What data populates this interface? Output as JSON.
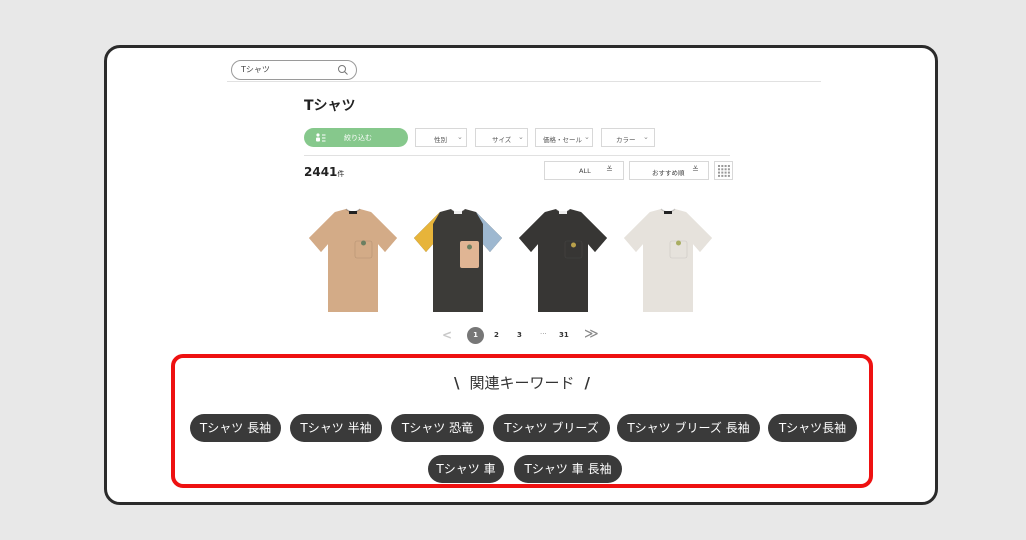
{
  "search": {
    "value": "Tシャツ"
  },
  "page": {
    "title": "Tシャツ"
  },
  "filters": {
    "narrow_label": "絞り込む",
    "dropdowns": [
      "性別",
      "サイズ",
      "価格・セール",
      "カラー"
    ]
  },
  "results": {
    "count": "2441",
    "unit": "件"
  },
  "sort": {
    "all_label": "ALL",
    "order_label": "おすすめ順"
  },
  "products": [
    {
      "body_color": "#d3ab87",
      "sleeve_left": "#d3ab87",
      "sleeve_right": "#d3ab87",
      "pocket": "#d3ab87"
    },
    {
      "body_color": "#3c3b38",
      "sleeve_left": "#e7b43a",
      "sleeve_right": "#9eb8d0",
      "pocket": "#e0b594"
    },
    {
      "body_color": "#373634",
      "sleeve_left": "#373634",
      "sleeve_right": "#373634",
      "pocket": "#373634"
    },
    {
      "body_color": "#e6e2dc",
      "sleeve_left": "#e6e2dc",
      "sleeve_right": "#e6e2dc",
      "pocket": "#e6e2dc"
    }
  ],
  "pagination": {
    "prev": "<",
    "pages": [
      "1",
      "2",
      "3"
    ],
    "dots": "···",
    "last": "31",
    "next": "≫",
    "current": "1"
  },
  "keywords": {
    "heading": "関連キーワード",
    "slash_left": "\\",
    "slash_right": "/",
    "items": [
      "Tシャツ 長袖",
      "Tシャツ 半袖",
      "Tシャツ 恐竜",
      "Tシャツ ブリーズ",
      "Tシャツ ブリーズ 長袖",
      "Tシャツ長袖",
      "Tシャツ 車",
      "Tシャツ 車 長袖"
    ]
  },
  "colors": {
    "accent_green": "#86c88c",
    "highlight_red": "#ee1111",
    "chip_bg": "#3a3a3a"
  }
}
